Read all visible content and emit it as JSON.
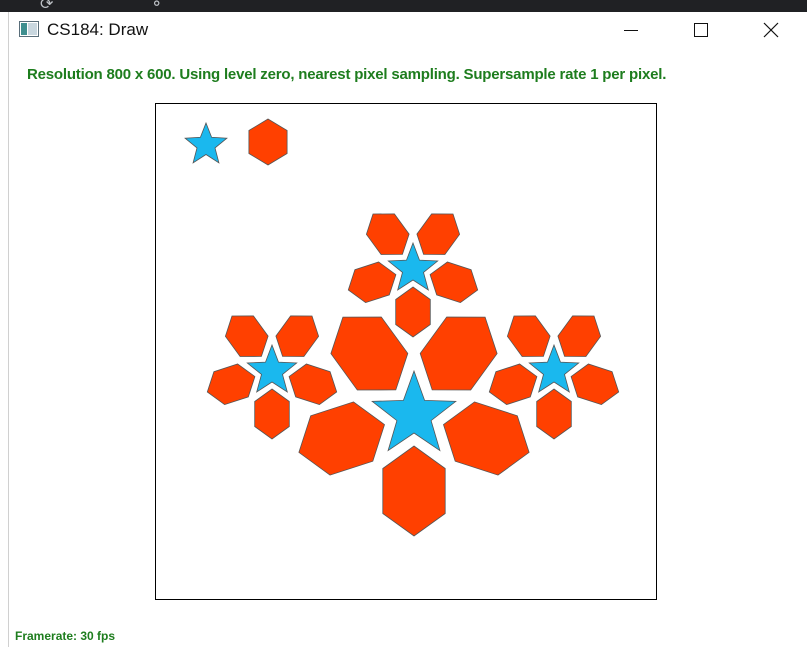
{
  "window": {
    "title": "CS184: Draw"
  },
  "status": {
    "info": "Resolution 800 x 600. Using level zero, nearest pixel sampling. Supersample rate 1 per pixel.",
    "framerate": "Framerate: 30 fps"
  },
  "colors": {
    "star": "#1ab8ee",
    "hexagon": "#ff4000",
    "outline": "#555555",
    "status_text": "#1e7d1e"
  },
  "icons": {
    "app": "app-window-icon",
    "minimize": "minimize-icon",
    "maximize": "maximize-icon",
    "close": "close-icon"
  }
}
